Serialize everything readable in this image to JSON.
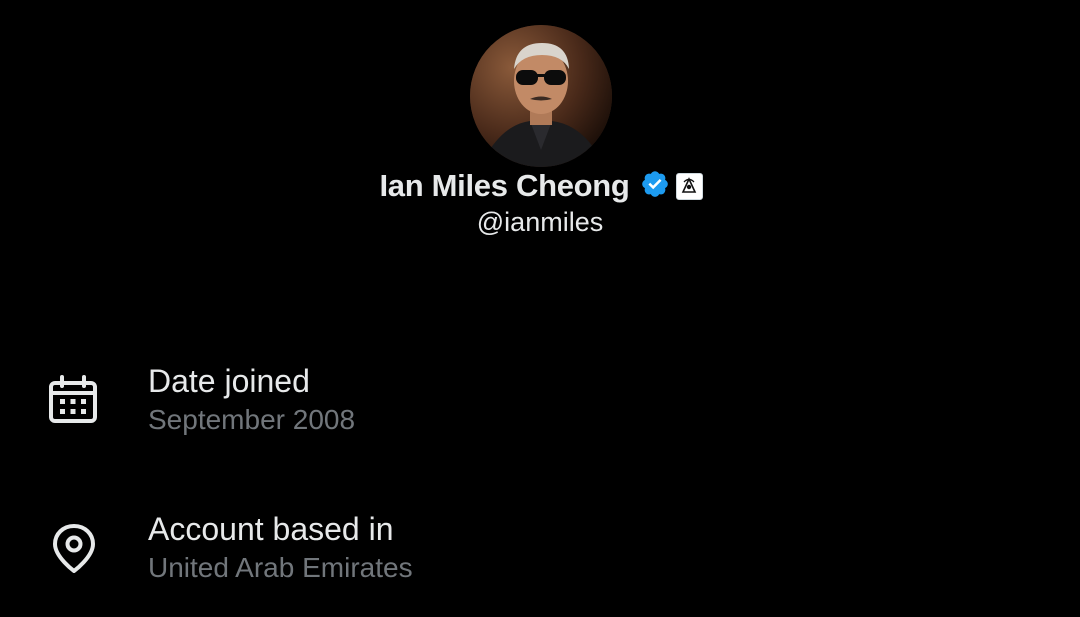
{
  "profile": {
    "display_name": "Ian Miles Cheong",
    "handle": "@ianmiles",
    "avatar_icon": "user-avatar-photo",
    "verified_icon": "verified-badge-icon",
    "affiliate_icon": "affiliate-badge-icon"
  },
  "about": {
    "joined": {
      "title": "Date joined",
      "value": "September 2008",
      "icon": "calendar-icon"
    },
    "location": {
      "title": "Account based in",
      "value": "United Arab Emirates",
      "icon": "location-pin-icon"
    }
  },
  "colors": {
    "background": "#000000",
    "primary_text": "#e7e9ea",
    "secondary_text": "#71767b",
    "verified_blue": "#1d9bf0"
  }
}
